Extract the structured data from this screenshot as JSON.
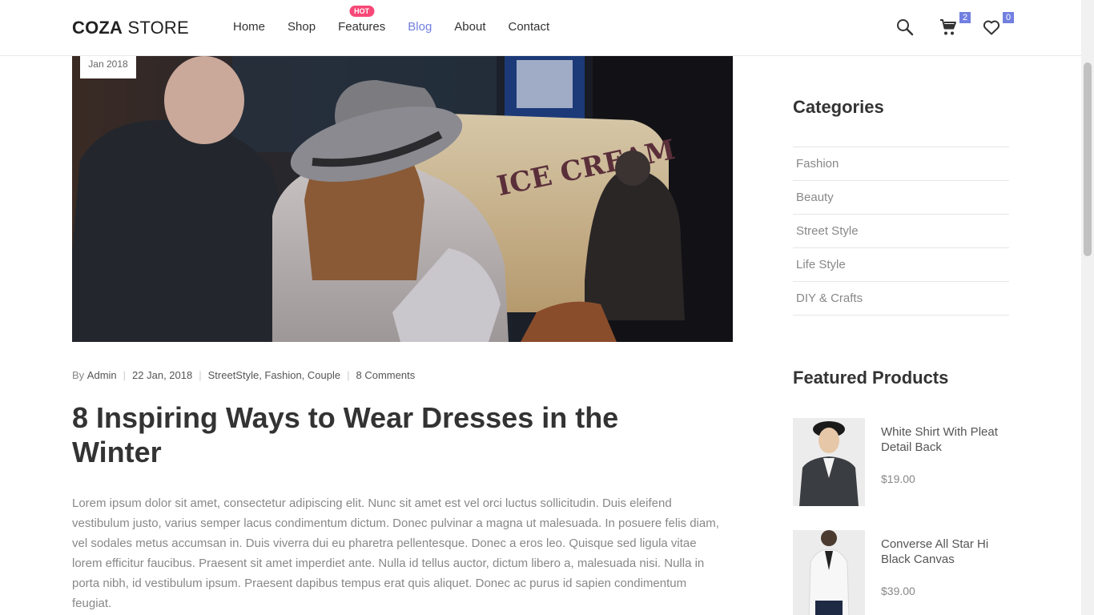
{
  "header": {
    "logo_bold": "COZA",
    "logo_rest": " STORE",
    "nav": [
      {
        "label": "Home"
      },
      {
        "label": "Shop"
      },
      {
        "label": "Features",
        "badge": "HOT"
      },
      {
        "label": "Blog",
        "active": true
      },
      {
        "label": "About"
      },
      {
        "label": "Contact"
      }
    ],
    "cart_count": "2",
    "wishlist_count": "0",
    "accent_color": "#717fe0",
    "hot_color": "#f74877"
  },
  "post": {
    "date_badge": "Jan 2018",
    "meta": {
      "by": "By",
      "author": "Admin",
      "date": "22 Jan, 2018",
      "tags": "StreetStyle, Fashion, Couple",
      "comments": "8 Comments"
    },
    "title": "8 Inspiring Ways to Wear Dresses in the Winter",
    "body": "Lorem ipsum dolor sit amet, consectetur adipiscing elit. Nunc sit amet est vel orci luctus sollicitudin. Duis eleifend vestibulum justo, varius semper lacus condimentum dictum. Donec pulvinar a magna ut malesuada. In posuere felis diam, vel sodales metus accumsan in. Duis viverra dui eu pharetra pellentesque. Donec a eros leo. Quisque sed ligula vitae lorem efficitur faucibus. Praesent sit amet imperdiet ante. Nulla id tellus auctor, dictum libero a, malesuada nisi. Nulla in porta nibh, id vestibulum ipsum. Praesent dapibus tempus erat quis aliquet. Donec ac purus id sapien condimentum feugiat."
  },
  "sidebar": {
    "categories_title": "Categories",
    "categories": [
      "Fashion",
      "Beauty",
      "Street Style",
      "Life Style",
      "DIY & Crafts"
    ],
    "featured_title": "Featured Products",
    "products": [
      {
        "name": "White Shirt With Pleat Detail Back",
        "price": "$19.00"
      },
      {
        "name": "Converse All Star Hi Black Canvas",
        "price": "$39.00"
      }
    ]
  }
}
